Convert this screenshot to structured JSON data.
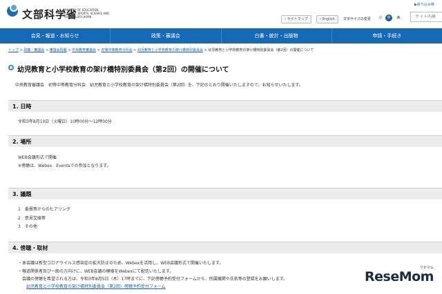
{
  "header": {
    "logo": "文部科学省",
    "logo_sub": "MINISTRY OF EDUCATION, CULTURE, SPORTS, SCIENCE AND TECHNOLOGY-JAPAN",
    "sitemap": "サイトマップ",
    "english": "English",
    "font_size_label": "文字サイズの変更",
    "font_small": "小",
    "font_mid": "中",
    "font_large": "大",
    "top_link": "絞り込み検",
    "search_placeholder": "サイト内検"
  },
  "nav": {
    "items": [
      "会見・報道・お知らせ",
      "政策・審議会",
      "白書・統計・出版物",
      "申請・手続き"
    ]
  },
  "breadcrumb": {
    "items": [
      "トップ",
      "政策・審議会",
      "審議会情報",
      "中央教育審議会",
      "初等中等教育分科会",
      "幼児教育と小学校教育の架け橋特別委員会"
    ],
    "current": "幼児教育と小学校教育の架け橋特別委員会（第2回）の開催について"
  },
  "main": {
    "title": "幼児教育と小学校教育の架け橋特別委員会（第2回）の開催について",
    "intro": "中央教育審議会　初等中等教育分科会　幼児教育と小学校教育の架け橋特別委員会（第2回）を、下記のとおり開催いたしますので、お知らせいたします。",
    "sections": [
      {
        "heading": "1. 日時",
        "lines": [
          "令和3年8月10日（火曜日）10時00分～12時00分"
        ]
      },
      {
        "heading": "2. 場所",
        "lines": [
          "WEB会議形式で開催",
          "※傍聴は、Webex　Eventsでの参加となります。"
        ]
      },
      {
        "heading": "3. 議題",
        "lines": [
          "1　委員等からのヒアリング",
          "2　意見交換等",
          "3　その他"
        ]
      },
      {
        "heading": "4. 傍聴・取材",
        "lines": [
          "・本会議は新型コロナウイルス感染症の拡大防止のため、Webexを活用し、WEB会議形式で開催いたします。",
          "・報道関係者及び一般の方向けに、WEB会議の模様をWebexにて配信いたします。",
          "　会議の傍聴を希望される方は、令和3年8月5日（木）17時までに、下記傍聴予約受付フォームから、所属機関や氏名等の登録をお願いします。"
        ],
        "link": "幼児教育と小学校教育の架け橋特別委員会（第2回）傍聴予約受付フォーム"
      }
    ]
  },
  "watermark": {
    "brand": "ReseMom",
    "sub": "リセマム"
  }
}
